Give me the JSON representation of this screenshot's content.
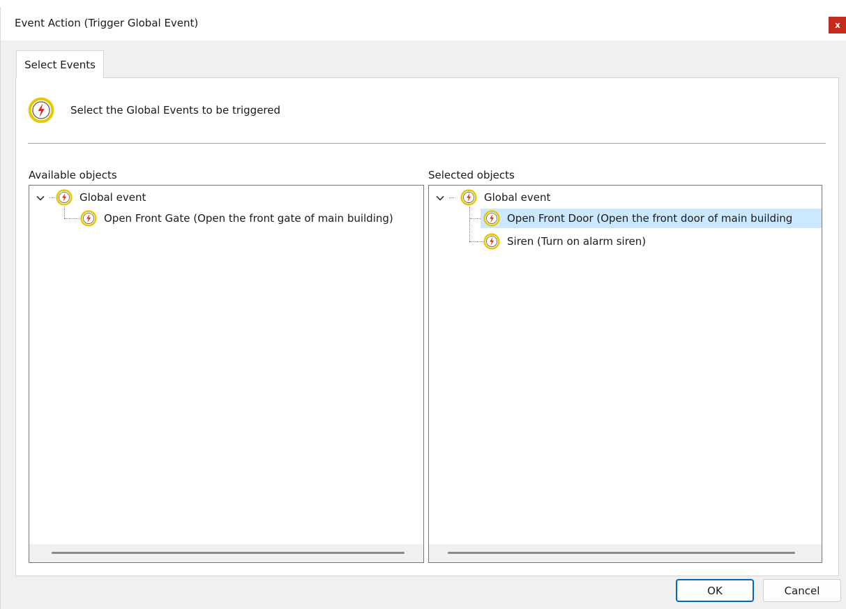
{
  "window": {
    "title": "Event Action (Trigger Global Event)",
    "close_label": "x"
  },
  "tabs": [
    {
      "label": "Select Events"
    }
  ],
  "header": {
    "text": "Select the Global Events to be triggered",
    "icon": "global-event-icon"
  },
  "available": {
    "label": "Available objects",
    "root": {
      "label": "Global event",
      "icon": "global-event-icon",
      "expanded": true
    },
    "children": [
      {
        "label": "Open Front Gate (Open the front gate of main building)",
        "icon": "global-event-icon"
      }
    ]
  },
  "selected": {
    "label": "Selected objects",
    "root": {
      "label": "Global event",
      "icon": "global-event-icon",
      "expanded": true
    },
    "children": [
      {
        "label": "Open Front Door (Open the front door of main building",
        "icon": "global-event-icon",
        "highlighted": true
      },
      {
        "label": "Siren (Turn on alarm siren)",
        "icon": "global-event-icon"
      }
    ]
  },
  "buttons": {
    "ok_label": "OK",
    "cancel_label": "Cancel"
  },
  "colors": {
    "icon_ring": "#e8c800",
    "icon_bolt": "#d42a1e",
    "selection": "#cce8ff",
    "close": "#c42b1c",
    "default_button_border": "#0067c0"
  }
}
